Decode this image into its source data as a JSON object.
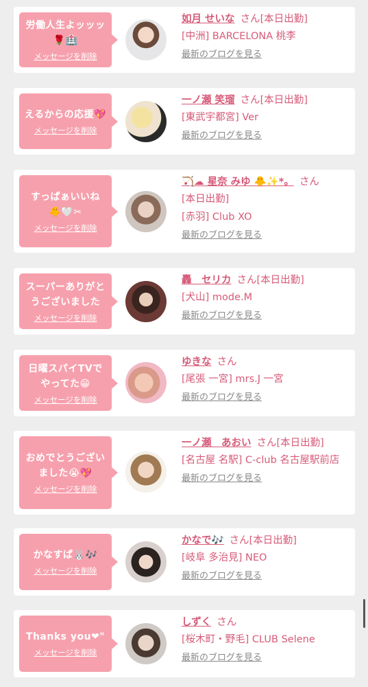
{
  "delete_label": "メッセージを削除",
  "blog_label": "最新のブログを見る",
  "honorific": "さん",
  "cards": [
    {
      "message": "労働人生よッッッ🌹🏥",
      "name": "如月 せいな",
      "status": "[本日出勤]",
      "shop": "[中洲] BARCELONA 桃李"
    },
    {
      "message": "えるからの応援💖",
      "name": "一ノ瀬 笑瑠",
      "status": "[本日出勤]",
      "shop": "[東武宇都宮] Ver"
    },
    {
      "message": "すっぱぁいいね🐥🤍✂",
      "name": "🏹☁ 星奈 みゆ 🐥✨*。",
      "status": "[本日出勤]",
      "shop": "[赤羽] Club XO"
    },
    {
      "message": "スーパーありがとうございました",
      "name": "轟　セリカ",
      "status": "[本日出勤]",
      "shop": "[犬山] mode.M"
    },
    {
      "message": "日曜スパイTVでやってた😁",
      "name": "ゆきな",
      "status": "",
      "shop": "[尾張 一宮] mrs.J 一宮"
    },
    {
      "message": "おめでとうございました😭💖",
      "name": "一ノ瀬　あおい",
      "status": "[本日出勤]",
      "shop": "[名古屋 名駅] C-club 名古屋駅前店"
    },
    {
      "message": "かなすぱ🐰🎶",
      "name": "かなで🎶",
      "status": "[本日出勤]",
      "shop": "[岐阜 多治見] NEO"
    },
    {
      "message": "Thanks you❤\"",
      "name": "しずく",
      "status": "",
      "shop": "[桜木町・野毛] CLUB Selene"
    }
  ]
}
